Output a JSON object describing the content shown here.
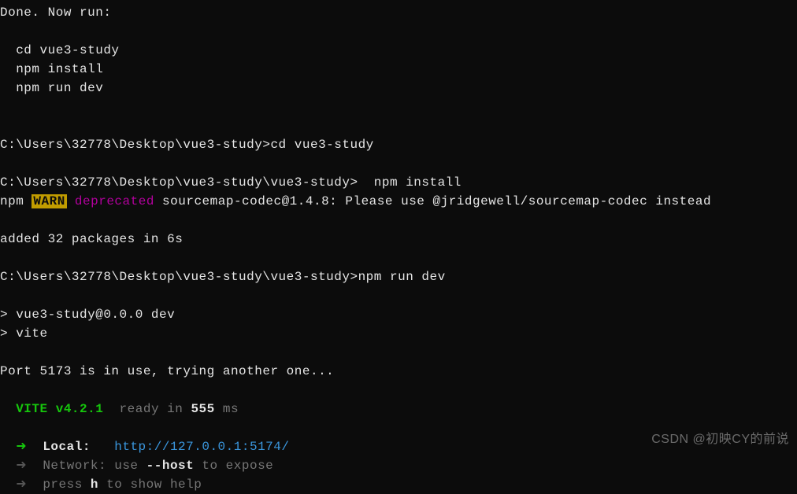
{
  "intro": {
    "done": "Done. Now run:",
    "cd": "  cd vue3-study",
    "install": "  npm install",
    "dev": "  npm run dev"
  },
  "prompt1": {
    "path": "C:\\Users\\32778\\Desktop\\vue3-study>",
    "cmd": "cd vue3-study"
  },
  "prompt2": {
    "path": "C:\\Users\\32778\\Desktop\\vue3-study\\vue3-study>  ",
    "cmd": "npm install"
  },
  "warn": {
    "npm": "npm ",
    "badge": "WARN",
    "deprecated": " deprecated",
    "msg": " sourcemap-codec@1.4.8: Please use @jridgewell/sourcemap-codec instead"
  },
  "added": "added 32 packages in 6s",
  "prompt3": {
    "path": "C:\\Users\\32778\\Desktop\\vue3-study\\vue3-study>",
    "cmd": "npm run dev"
  },
  "script": {
    "line1": "> vue3-study@0.0.0 dev",
    "line2": "> vite"
  },
  "port": "Port 5173 is in use, trying another one...",
  "vite": {
    "label": "  VITE v4.2.1",
    "ready": "  ready in ",
    "time": "555",
    "ms": " ms"
  },
  "local": {
    "arrow": "  ➜  ",
    "label": "Local:   ",
    "url": "http://127.0.0.1:5174/"
  },
  "network": {
    "arrow": "  ➜  ",
    "label": "Network: use ",
    "host": "--host",
    "rest": " to expose"
  },
  "help": {
    "arrow": "  ➜  ",
    "label": "press ",
    "key": "h",
    "rest": " to show help"
  },
  "watermark": "CSDN @初映CY的前说"
}
